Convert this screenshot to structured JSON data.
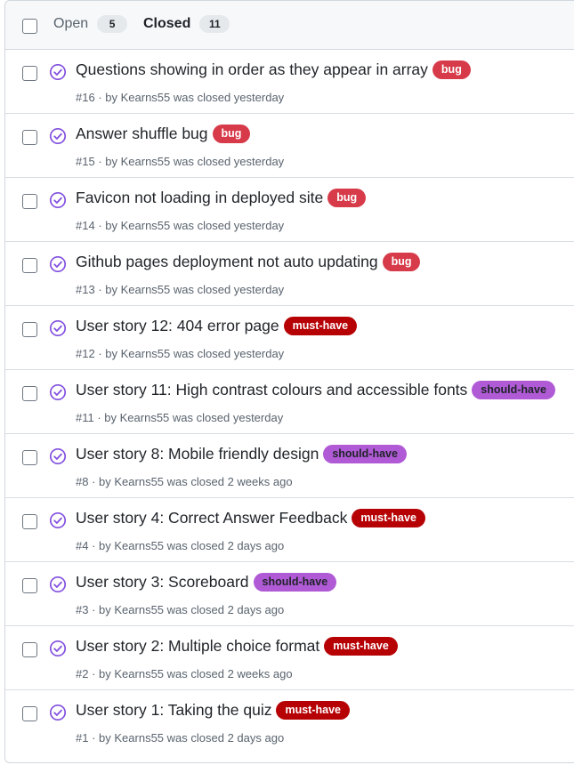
{
  "tabs": {
    "open_label": "Open",
    "open_count": "5",
    "closed_label": "Closed",
    "closed_count": "11"
  },
  "colors": {
    "closed_icon": "#8250df",
    "bug": "#d73a49",
    "must_have": "#b60205",
    "should_have": "#b05ad6"
  },
  "issues": [
    {
      "title": "Questions showing in order as they appear in array",
      "label": "bug",
      "label_type": "bug",
      "number": "#16",
      "author": "Kearns55",
      "closed": "was closed yesterday"
    },
    {
      "title": "Answer shuffle bug",
      "label": "bug",
      "label_type": "bug",
      "number": "#15",
      "author": "Kearns55",
      "closed": "was closed yesterday"
    },
    {
      "title": "Favicon not loading in deployed site",
      "label": "bug",
      "label_type": "bug",
      "number": "#14",
      "author": "Kearns55",
      "closed": "was closed yesterday"
    },
    {
      "title": "Github pages deployment not auto updating",
      "label": "bug",
      "label_type": "bug",
      "number": "#13",
      "author": "Kearns55",
      "closed": "was closed yesterday"
    },
    {
      "title": "User story 12: 404 error page",
      "label": "must-have",
      "label_type": "must-have",
      "number": "#12",
      "author": "Kearns55",
      "closed": "was closed yesterday"
    },
    {
      "title": "User story 11: High contrast colours and accessible fonts",
      "label": "should-have",
      "label_type": "should-have",
      "number": "#11",
      "author": "Kearns55",
      "closed": "was closed yesterday"
    },
    {
      "title": "User story 8: Mobile friendly design",
      "label": "should-have",
      "label_type": "should-have",
      "number": "#8",
      "author": "Kearns55",
      "closed": "was closed 2 weeks ago"
    },
    {
      "title": "User story 4: Correct Answer Feedback",
      "label": "must-have",
      "label_type": "must-have",
      "number": "#4",
      "author": "Kearns55",
      "closed": "was closed 2 days ago"
    },
    {
      "title": "User story 3: Scoreboard",
      "label": "should-have",
      "label_type": "should-have",
      "number": "#3",
      "author": "Kearns55",
      "closed": "was closed 2 days ago"
    },
    {
      "title": "User story 2: Multiple choice format",
      "label": "must-have",
      "label_type": "must-have",
      "number": "#2",
      "author": "Kearns55",
      "closed": "was closed 2 weeks ago"
    },
    {
      "title": "User story 1: Taking the quiz",
      "label": "must-have",
      "label_type": "must-have",
      "number": "#1",
      "author": "Kearns55",
      "closed": "was closed 2 days ago"
    }
  ]
}
